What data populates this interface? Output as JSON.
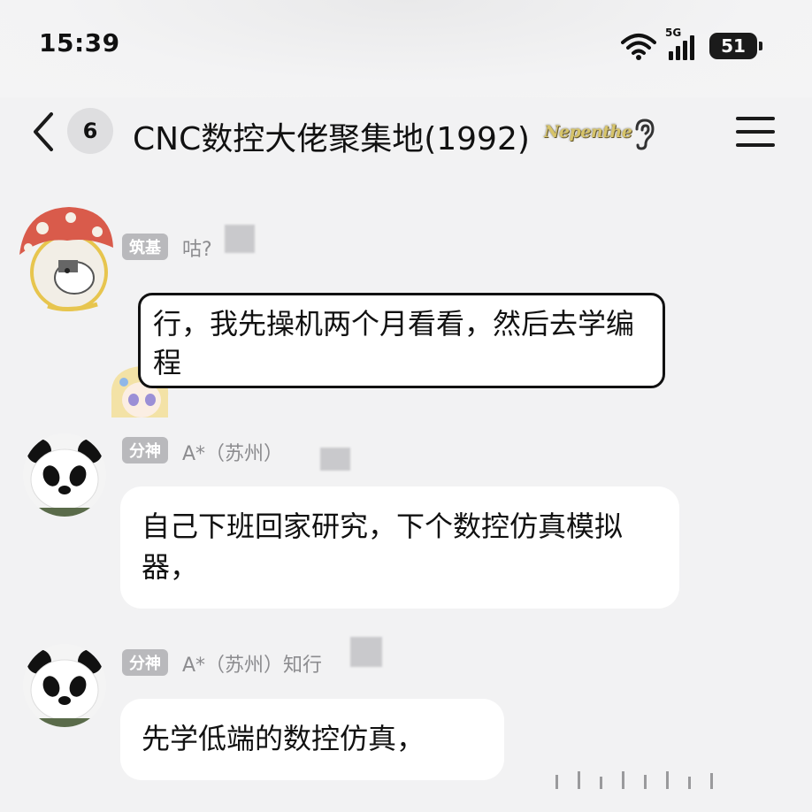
{
  "status_bar": {
    "time": "15:39",
    "network": "5G",
    "battery": "51"
  },
  "header": {
    "back_icon": "chevron-left-icon",
    "unread_count": "6",
    "title": "CNC数控大佬聚集地(1992)",
    "badge_text": "Nepenthe",
    "ear_icon": "ear-icon",
    "menu_icon": "hamburger-menu-icon"
  },
  "messages": [
    {
      "tag": "筑基",
      "sender": "咕?",
      "bubble_text": "行，我先操机两个月看看，然后去学编程"
    },
    {
      "tag": "分神",
      "sender": "A*（苏州）",
      "bubble_text": "自己下班回家研究，下个数控仿真模拟器，"
    },
    {
      "tag": "分神",
      "sender": "A*（苏州）知行",
      "bubble_text": "先学低端的数控仿真，"
    }
  ],
  "colors": {
    "background": "#f2f2f3",
    "bubble": "#ffffff",
    "tag_bg": "#b9b9bc",
    "sender_text": "#8c8c8f"
  }
}
